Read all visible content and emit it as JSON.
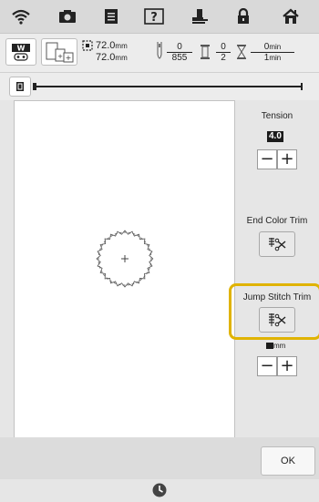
{
  "info": {
    "width": "72.0",
    "height": "72.0",
    "unit": "mm",
    "stitch_num": "0",
    "stitch_den": "855",
    "color_num": "0",
    "color_den": "2",
    "time_num": "0",
    "time_den": "1",
    "time_unit": "min"
  },
  "tension": {
    "label": "Tension",
    "value": "4.0"
  },
  "end_color_trim": {
    "label": "End Color Trim"
  },
  "jump_stitch_trim": {
    "label": "Jump Stitch Trim",
    "unit": "mm"
  },
  "ok_label": "OK",
  "colors": {
    "highlight": "#e0b300"
  }
}
